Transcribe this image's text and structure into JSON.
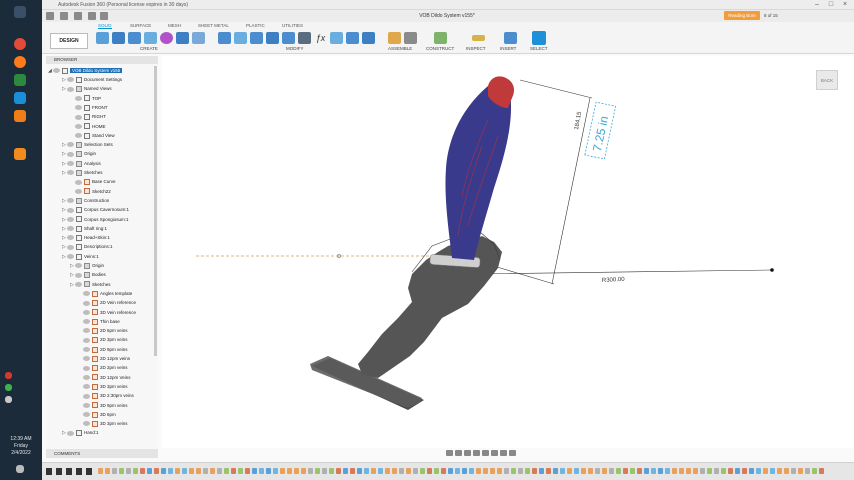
{
  "window": {
    "title": "Autodesk Fusion 360 (Personal license expires in 30 days)",
    "document_tab": "VOB Dildo System v155*",
    "reading_button": "Reading Bore",
    "job_status": "8 of 15"
  },
  "taskbar": {
    "time": "12:39 AM",
    "day": "Friday",
    "date": "2/4/2022"
  },
  "ribbon": {
    "tabs": [
      "SOLID",
      "SURFACE",
      "MESH",
      "SHEET METAL",
      "PLASTIC",
      "UTILITIES"
    ],
    "active_tab": "SOLID",
    "workspace_button": "DESIGN",
    "groups": [
      "CREATE",
      "MODIFY",
      "ASSEMBLE",
      "CONSTRUCT",
      "INSPECT",
      "INSERT",
      "SELECT"
    ]
  },
  "browser": {
    "header": "BROWSER",
    "root": "VOB Dildo System v155",
    "items": [
      "Document Settings",
      "Named Views",
      "TOP",
      "FRONT",
      "RIGHT",
      "HOME",
      "Stand View",
      "Selection Sets",
      "Origin",
      "Analysis",
      "Sketches",
      "Base Curve",
      "Sketch22",
      "Construction",
      "Corpus Cavernosum:1",
      "Corpus Spongiosum:1",
      "Shaft ring:1",
      "Head+Skin:1",
      "Descriptions:1",
      "Veins:1",
      "Origin",
      "Bodies",
      "Sketches",
      "Angles template",
      "2D Vein reference",
      "3D Vein reference",
      "Thin base",
      "2D 6pm veins",
      "2D 3pm veins",
      "2D 9pm veins",
      "2D 12pm veins",
      "2D 2pm veins",
      "3D 12pm Veins",
      "3D 3pm veins",
      "3D 2:30pm veins",
      "3D 9pm veins",
      "3D 6pm",
      "3D 3pm veins",
      "Hand:1"
    ],
    "comments": "COMMENTS"
  },
  "viewport": {
    "viewcube_label": "BACK",
    "dimension_length": "184.15",
    "dimension_overlay": "7.25 in",
    "dimension_radius": "R300.00"
  },
  "colors": {
    "accent": "#0696d7",
    "shaft": "#3a3a8c",
    "head": "#c0393b",
    "hand": "#4a4a4a",
    "reading_button": "#f39c38"
  }
}
